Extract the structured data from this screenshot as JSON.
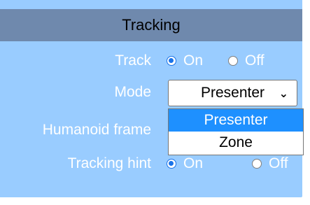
{
  "section": {
    "title": "Tracking"
  },
  "rows": {
    "track": {
      "label": "Track",
      "options": [
        "On",
        "Off"
      ],
      "selected": "On"
    },
    "mode": {
      "label": "Mode",
      "value": "Presenter",
      "options": [
        "Presenter",
        "Zone"
      ]
    },
    "humanoid": {
      "label": "Humanoid frame"
    },
    "hint": {
      "label": "Tracking hint",
      "options": [
        "On",
        "Off"
      ],
      "selected": "On"
    }
  },
  "icons": {
    "dropdown_chevron": "chevron-down-icon"
  },
  "colors": {
    "panel_bg": "#99ccff",
    "header_bg": "#6f89ad",
    "accent": "#1a73e8",
    "selected_option_bg": "#1e90ff"
  }
}
